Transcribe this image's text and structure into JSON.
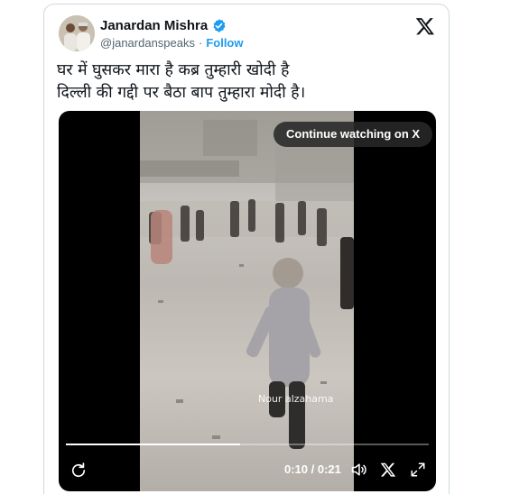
{
  "author": {
    "name": "Janardan Mishra",
    "handle": "@janardanspeaks",
    "separator": "·",
    "follow_label": "Follow"
  },
  "tweet": {
    "lines": [
      "घर में घुसकर मारा है कब्र तुम्हारी खोदी है",
      "दिल्ली की गद्दी पर बैठा बाप तुम्हारा मोदी है।"
    ]
  },
  "video": {
    "continue_label": "Continue watching on X",
    "watermark": "Nour alzahama",
    "time": "0:10 / 0:21",
    "progress": 0.48
  },
  "icons": {
    "verified": "verified-badge-icon",
    "x_logo": "x-logo-icon",
    "replay": "replay-icon",
    "volume": "volume-icon",
    "fullscreen": "fullscreen-icon"
  },
  "colors": {
    "accent": "#1d9bf0",
    "text": "#0f1419",
    "muted": "#536471",
    "border": "#cfd9de"
  }
}
